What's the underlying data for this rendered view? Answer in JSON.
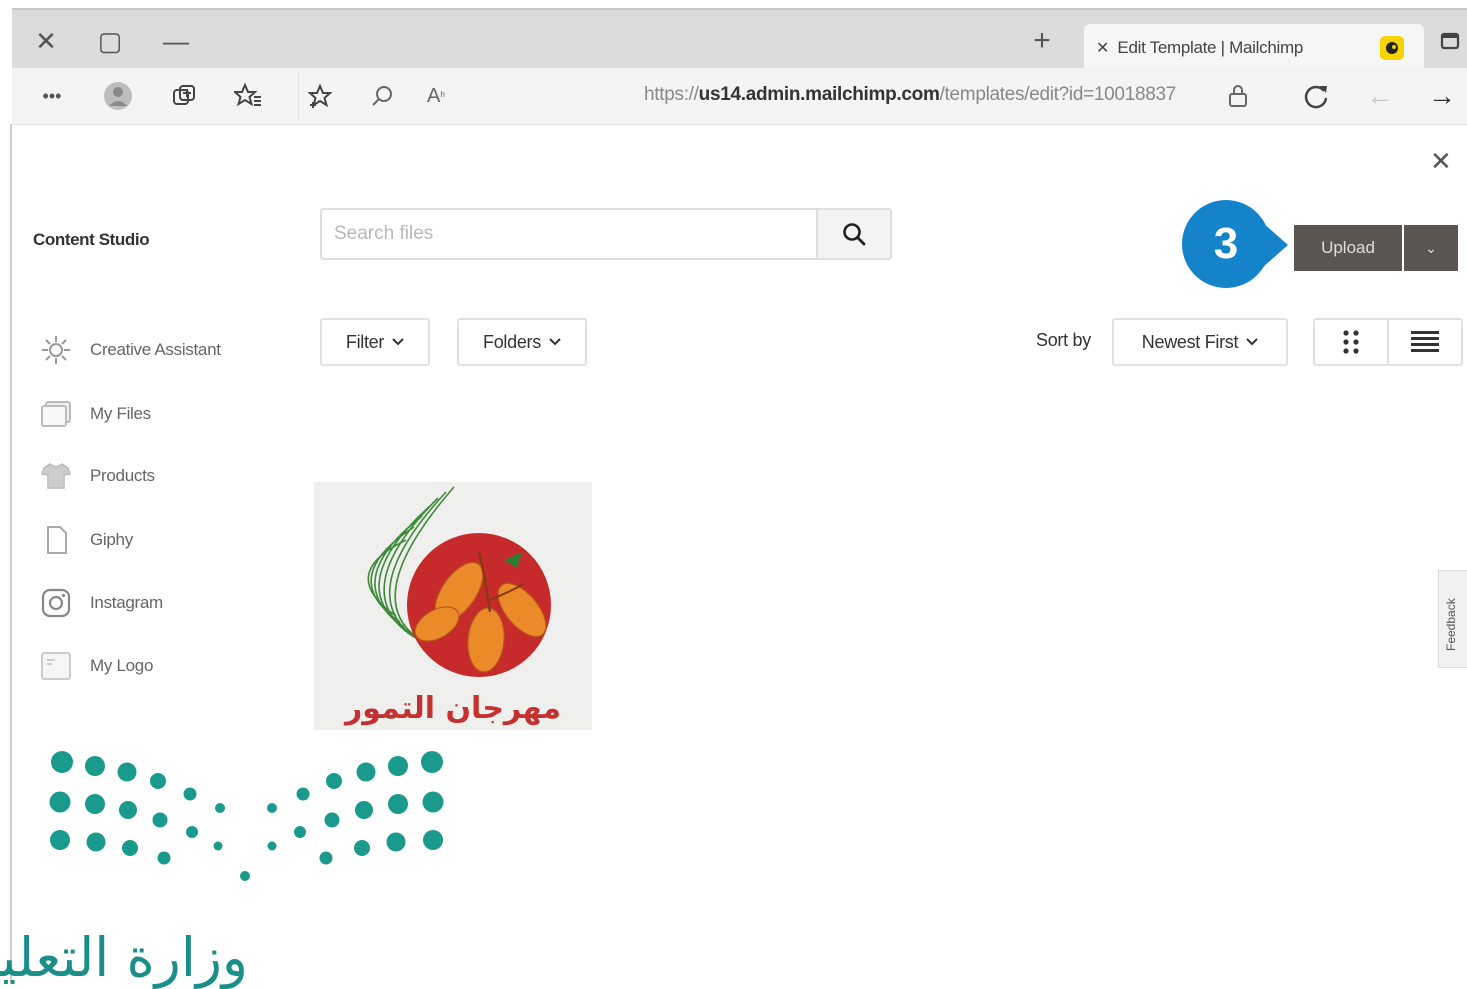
{
  "browser": {
    "window_controls": {
      "close": "✕",
      "maximize": "▢",
      "minimize": "—"
    },
    "new_tab": "+",
    "tab": {
      "title": "Edit Template | Mailchimp",
      "close": "✕"
    },
    "url": {
      "prefix": "https://",
      "domain": "us14.admin.mailchimp.com",
      "path": "/templates/edit?id=10018837"
    }
  },
  "content_studio": {
    "title": "Content Studio",
    "close": "✕",
    "search": {
      "placeholder": "Search files"
    },
    "upload": {
      "label": "Upload"
    },
    "step_badge": "3",
    "filter_label": "Filter",
    "folders_label": "Folders",
    "sort_by_label": "Sort by",
    "sort_value": "Newest First",
    "nav": [
      {
        "label": "Creative Assistant",
        "icon": "sparkle-icon"
      },
      {
        "label": "My Files",
        "icon": "files-icon"
      },
      {
        "label": "Products",
        "icon": "shirt-icon"
      },
      {
        "label": "Giphy",
        "icon": "document-icon"
      },
      {
        "label": "Instagram",
        "icon": "instagram-icon"
      },
      {
        "label": "My Logo",
        "icon": "image-icon"
      }
    ],
    "file_thumbnail_text": "مهرجان التمور",
    "feedback_label": "Feedback"
  },
  "watermark": {
    "text": "وزارة التعليم"
  },
  "colors": {
    "accent": "#1583c9",
    "upload_bg": "#5b5651",
    "logo_red": "#c4312f",
    "moe_green": "#1a8f8a"
  }
}
